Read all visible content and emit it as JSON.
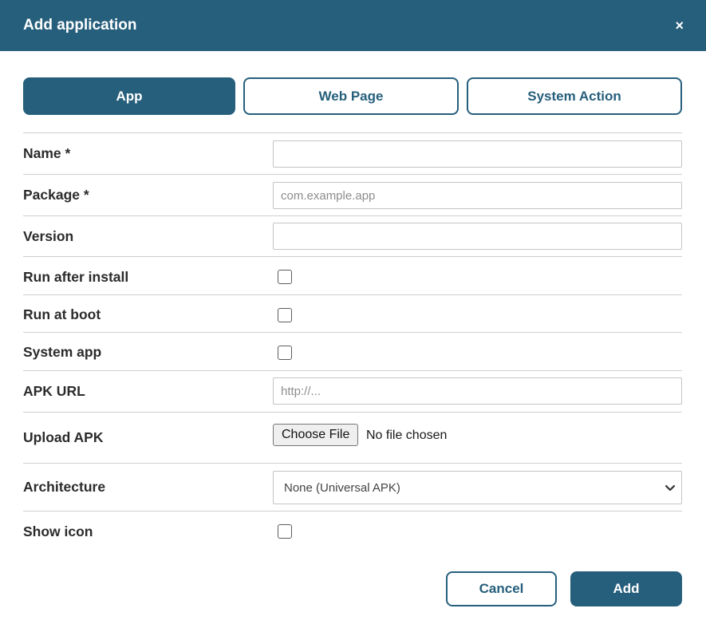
{
  "dialog": {
    "title": "Add application",
    "close_symbol": "×"
  },
  "tabs": [
    {
      "label": "App",
      "active": true
    },
    {
      "label": "Web Page",
      "active": false
    },
    {
      "label": "System Action",
      "active": false
    }
  ],
  "form": {
    "name": {
      "label": "Name *",
      "value": "",
      "placeholder": ""
    },
    "package": {
      "label": "Package *",
      "value": "",
      "placeholder": "com.example.app"
    },
    "version": {
      "label": "Version",
      "value": "",
      "placeholder": ""
    },
    "run_after_install": {
      "label": "Run after install",
      "checked": false
    },
    "run_at_boot": {
      "label": "Run at boot",
      "checked": false
    },
    "system_app": {
      "label": "System app",
      "checked": false
    },
    "apk_url": {
      "label": "APK URL",
      "value": "",
      "placeholder": "http://..."
    },
    "upload_apk": {
      "label": "Upload APK",
      "button_label": "Choose File",
      "status": "No file chosen"
    },
    "architecture": {
      "label": "Architecture",
      "selected": "None (Universal APK)"
    },
    "show_icon": {
      "label": "Show icon",
      "checked": false
    }
  },
  "actions": {
    "cancel_label": "Cancel",
    "add_label": "Add"
  },
  "colors": {
    "primary": "#265f7c",
    "divider": "#cfcfcf"
  },
  "icons": {
    "close": "close-icon",
    "dropdown": "chevron-down-icon"
  }
}
